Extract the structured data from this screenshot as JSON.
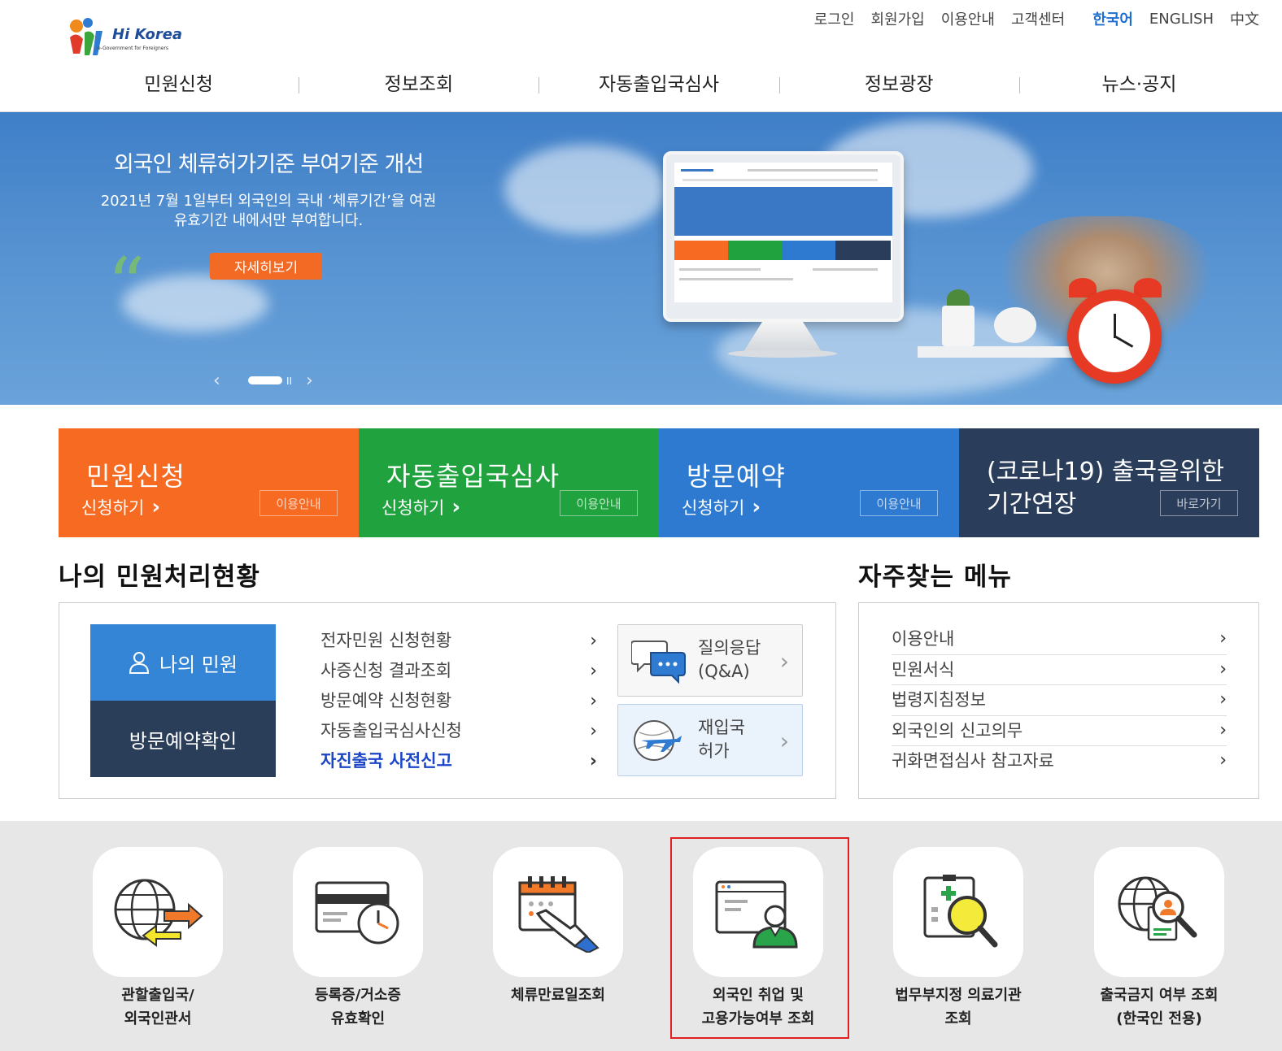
{
  "logo": {
    "brand": "Hi Korea",
    "tagline": "e-Government for Foreigners"
  },
  "util_menu": {
    "login": "로그인",
    "join": "회원가입",
    "guide": "이용안내",
    "support": "고객센터"
  },
  "languages": {
    "ko": "한국어",
    "en": "ENGLISH",
    "zh": "中文"
  },
  "gnb": [
    "민원신청",
    "정보조회",
    "자동출입국심사",
    "정보광장",
    "뉴스·공지"
  ],
  "banner": {
    "title": "외국인 체류허가기준 부여기준 개선",
    "desc_line1": "2021년 7월 1일부터 외국인의 국내 ‘체류기간’을 여권",
    "desc_line2": "유효기간 내에서만 부여합니다.",
    "more_label": "자세히보기",
    "prev": "‹",
    "next": "›",
    "pause": "II"
  },
  "tiles": [
    {
      "title": "민원신청",
      "apply": "신청하기",
      "guide": "이용안내",
      "color": "#f76a22"
    },
    {
      "title": "자동출입국심사",
      "apply": "신청하기",
      "guide": "이용안내",
      "color": "#20a33f"
    },
    {
      "title": "방문예약",
      "apply": "신청하기",
      "guide": "이용안내",
      "color": "#2d7ad0"
    },
    {
      "title_line1": "(코로나19) 출국을위한",
      "title_line2": "기간연장",
      "guide": "바로가기",
      "color": "#2a3d5a"
    }
  ],
  "my_status": {
    "title": "나의 민원처리현황",
    "my_civil": "나의 민원",
    "visit_check": "방문예약확인",
    "items": [
      "전자민원 신청현황",
      "사증신청 결과조회",
      "방문예약 신청현황",
      "자동출입국심사신청",
      "자진출국 사전신고"
    ],
    "qa_line1": "질의응답",
    "qa_line2": "(Q&A)",
    "reentry_line1": "재입국",
    "reentry_line2": "허가"
  },
  "favorites": {
    "title": "자주찾는 메뉴",
    "items": [
      "이용안내",
      "민원서식",
      "법령지침정보",
      "외국인의 신고의무",
      "귀화면접심사 참고자료"
    ]
  },
  "services": [
    {
      "label": "관할출입국/\n외국인관서",
      "icon": "globe-exchange-icon"
    },
    {
      "label": "등록증/거소증\n유효확인",
      "icon": "card-clock-icon"
    },
    {
      "label": "체류만료일조회",
      "icon": "calendar-hand-icon"
    },
    {
      "label": "외국인 취업 및\n고용가능여부 조회",
      "icon": "window-person-icon"
    },
    {
      "label": "법무부지정 의료기관\n조회",
      "icon": "clipboard-search-icon"
    },
    {
      "label": "출국금지 여부 조회\n(한국인 전용)",
      "icon": "globe-search-icon"
    }
  ],
  "arrow": "›"
}
